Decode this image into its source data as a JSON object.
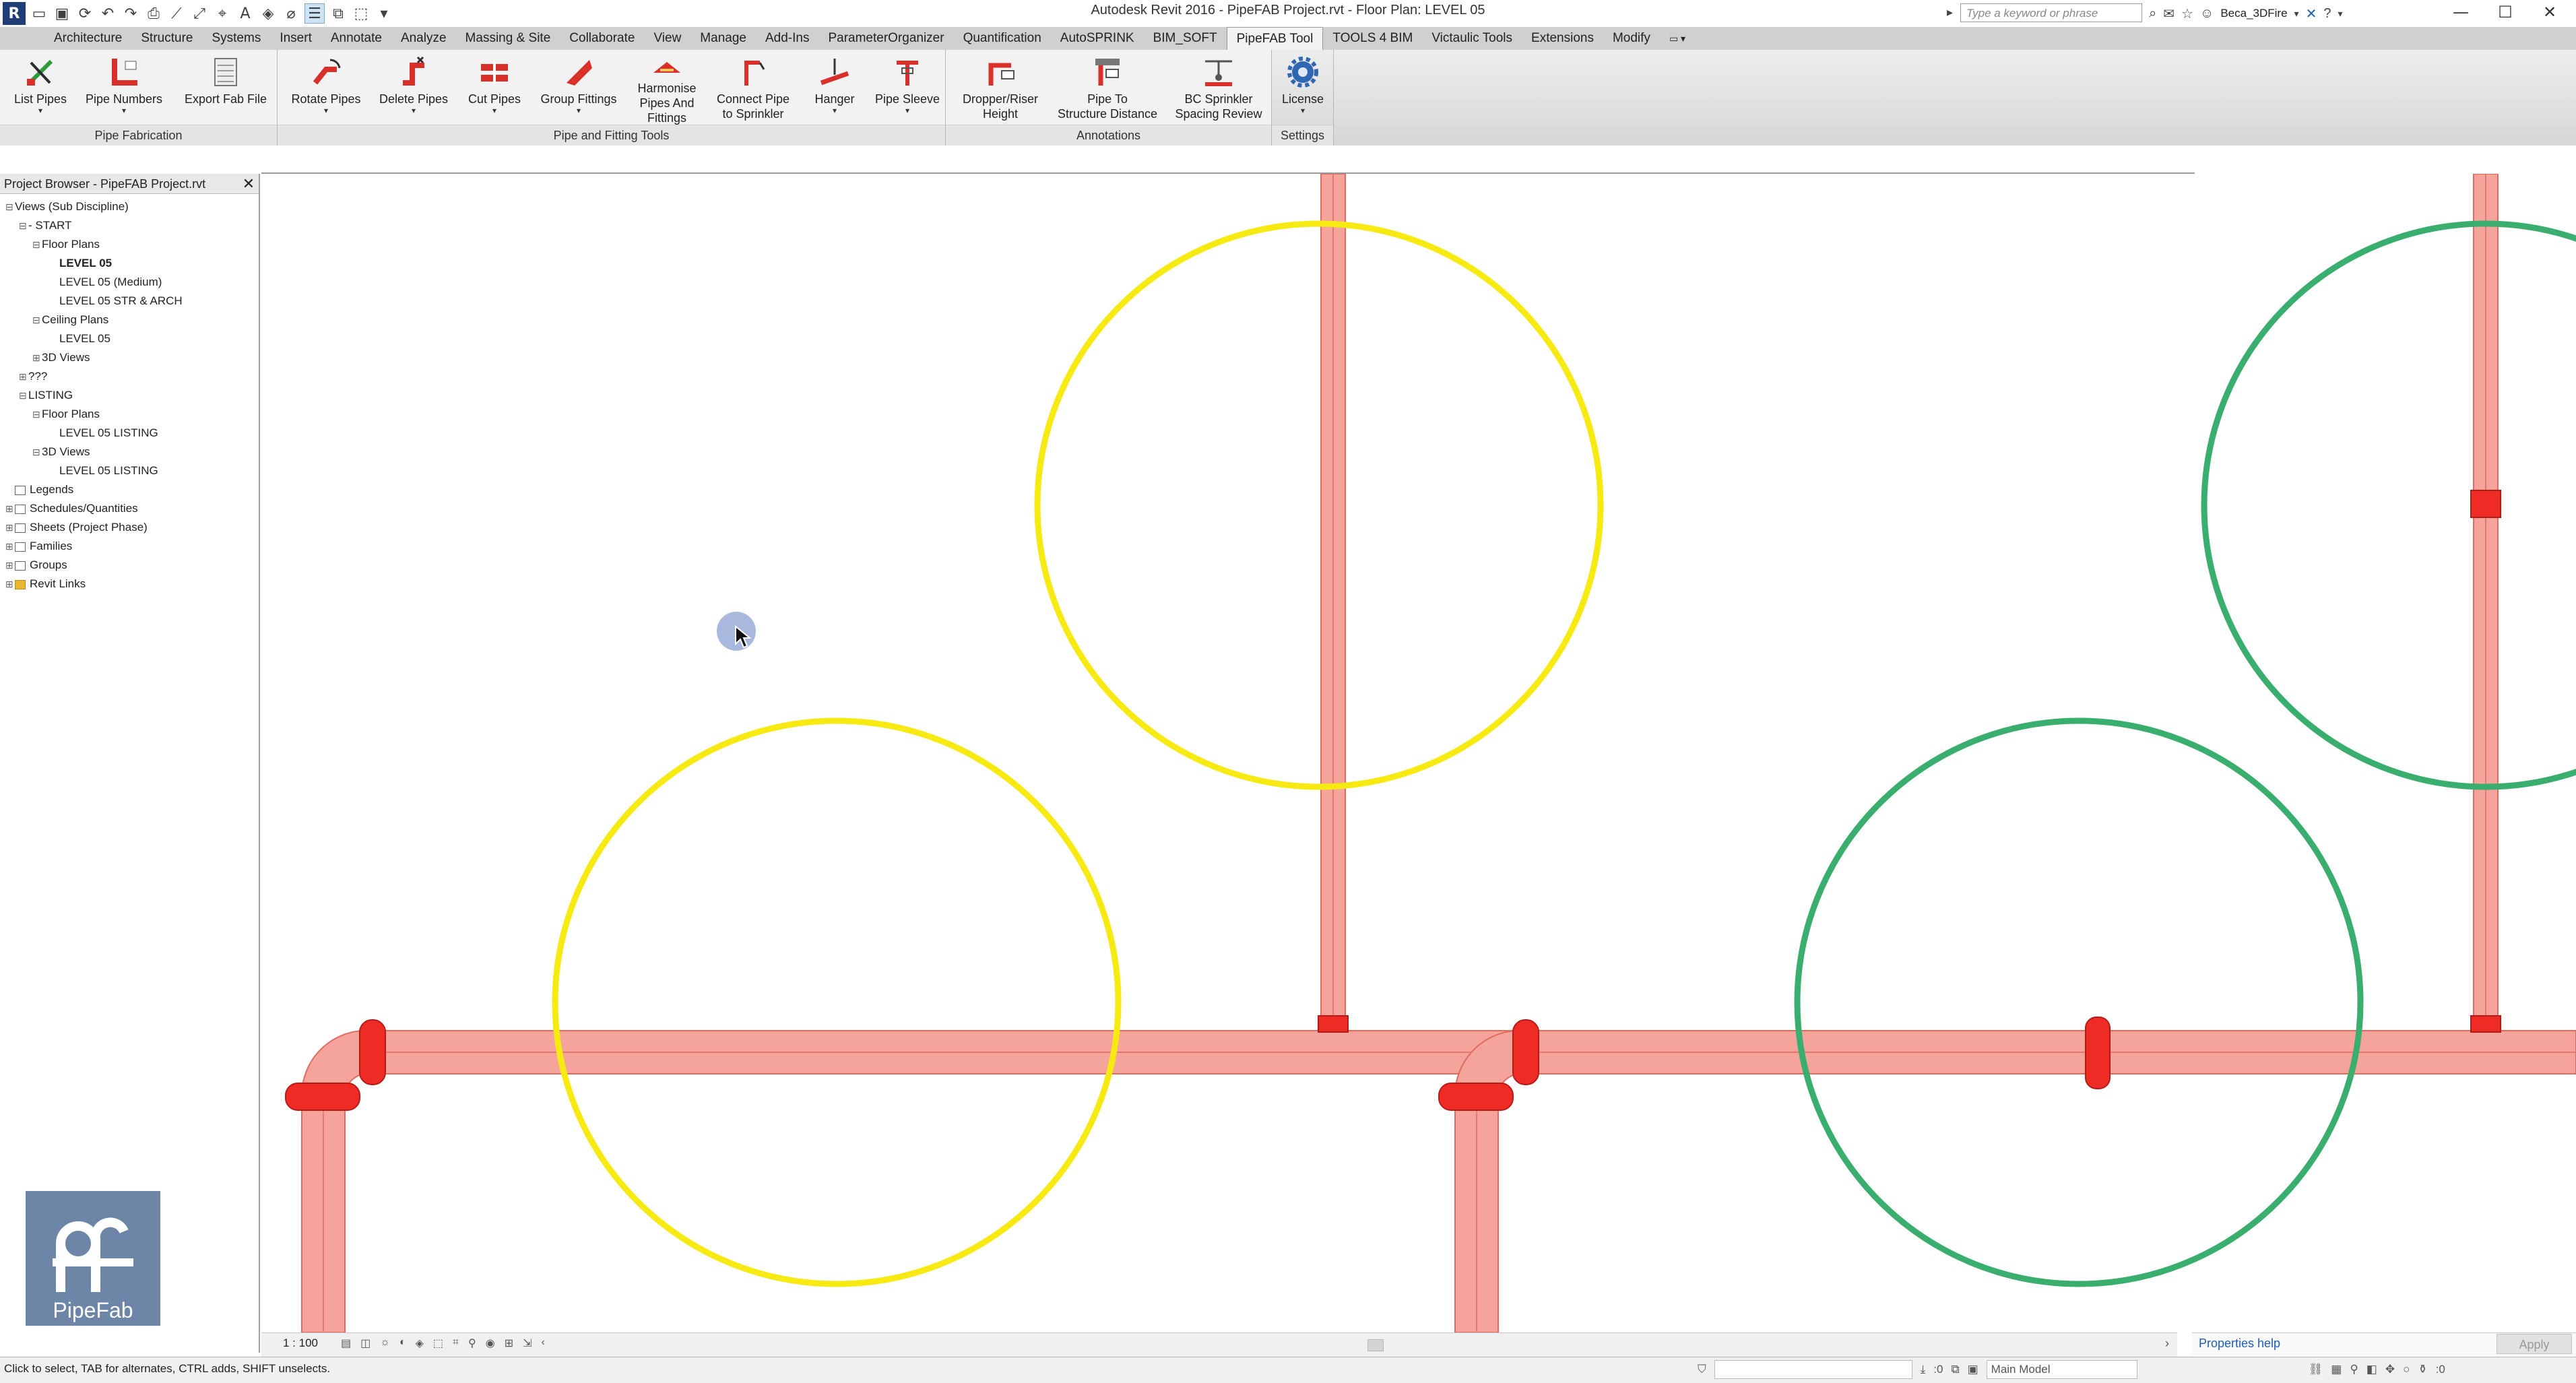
{
  "app": {
    "window_title": "Autodesk Revit 2016 -     PipeFAB Project.rvt - Floor Plan: LEVEL 05",
    "search_placeholder": "Type a keyword or phrase",
    "user": "Beca_3DFire"
  },
  "tabs": [
    {
      "label": "Architecture"
    },
    {
      "label": "Structure"
    },
    {
      "label": "Systems"
    },
    {
      "label": "Insert"
    },
    {
      "label": "Annotate"
    },
    {
      "label": "Analyze"
    },
    {
      "label": "Massing & Site"
    },
    {
      "label": "Collaborate"
    },
    {
      "label": "View"
    },
    {
      "label": "Manage"
    },
    {
      "label": "Add-Ins"
    },
    {
      "label": "ParameterOrganizer"
    },
    {
      "label": "Quantification"
    },
    {
      "label": "AutoSPRINK"
    },
    {
      "label": "BIM_SOFT"
    },
    {
      "label": "PipeFAB Tool",
      "active": true
    },
    {
      "label": "TOOLS 4 BIM"
    },
    {
      "label": "Victaulic Tools"
    },
    {
      "label": "Extensions"
    },
    {
      "label": "Modify"
    }
  ],
  "ribbon": {
    "panels": {
      "pipe_fabrication": "Pipe Fabrication",
      "pipe_fitting_tools": "Pipe and Fitting Tools",
      "annotations": "Annotations",
      "settings": "Settings"
    },
    "tools": {
      "list_pipes": "List Pipes",
      "pipe_numbers": "Pipe Numbers",
      "export_fab_file": "Export Fab File",
      "rotate_pipes": "Rotate Pipes",
      "delete_pipes": "Delete Pipes",
      "cut_pipes": "Cut Pipes",
      "group_fittings": "Group Fittings",
      "harmonise_1": "Harmonise",
      "harmonise_2": "Pipes And",
      "harmonise_3": "Fittings",
      "connect_1": "Connect Pipe",
      "connect_2": "to Sprinkler",
      "hanger": "Hanger",
      "pipe_sleeve": "Pipe Sleeve",
      "dropper_1": "Dropper/Riser",
      "dropper_2": "Height",
      "pipe_to_1": "Pipe To",
      "pipe_to_2": "Structure Distance",
      "bc_1": "BC Sprinkler",
      "bc_2": "Spacing Review",
      "license": "License"
    },
    "colors": {
      "accent_red": "#d9302a",
      "tab_active_bg": "#f2f2f2"
    }
  },
  "project_browser": {
    "title": "Project Browser - PipeFAB Project.rvt",
    "items": [
      {
        "label": "Views (Sub Discipline)"
      },
      {
        "label": "- START"
      },
      {
        "label": "Floor Plans"
      },
      {
        "label": "LEVEL 05",
        "selected": true
      },
      {
        "label": "LEVEL 05 (Medium)"
      },
      {
        "label": "LEVEL 05 STR & ARCH"
      },
      {
        "label": "Ceiling Plans"
      },
      {
        "label": "LEVEL 05"
      },
      {
        "label": "3D Views"
      },
      {
        "label": "???"
      },
      {
        "label": "LISTING"
      },
      {
        "label": "Floor Plans"
      },
      {
        "label": "LEVEL 05 LISTING"
      },
      {
        "label": "3D Views"
      },
      {
        "label": "LEVEL 05 LISTING"
      },
      {
        "label": "Legends"
      },
      {
        "label": "Schedules/Quantities"
      },
      {
        "label": "Sheets (Project Phase)"
      },
      {
        "label": "Families"
      },
      {
        "label": "Groups"
      },
      {
        "label": "Revit Links"
      }
    ]
  },
  "logo": {
    "text": "PipeFab"
  },
  "view_bar": {
    "scale": "1 : 100"
  },
  "properties": {
    "help_link": "Properties help",
    "apply_label": "Apply"
  },
  "status": {
    "message": "Click to select, TAB for alternates, CTRL adds, SHIFT unselects.",
    "coord": ":0",
    "model": "Main Model",
    "filter_count": ":0"
  },
  "canvas": {
    "colors": {
      "pipe_fill": "#f4a49a",
      "pipe_edge": "#e06a5e",
      "fitting": "#ee2b25",
      "circle_yellow": "#f6ea12",
      "circle_green": "#3aae6e"
    }
  }
}
